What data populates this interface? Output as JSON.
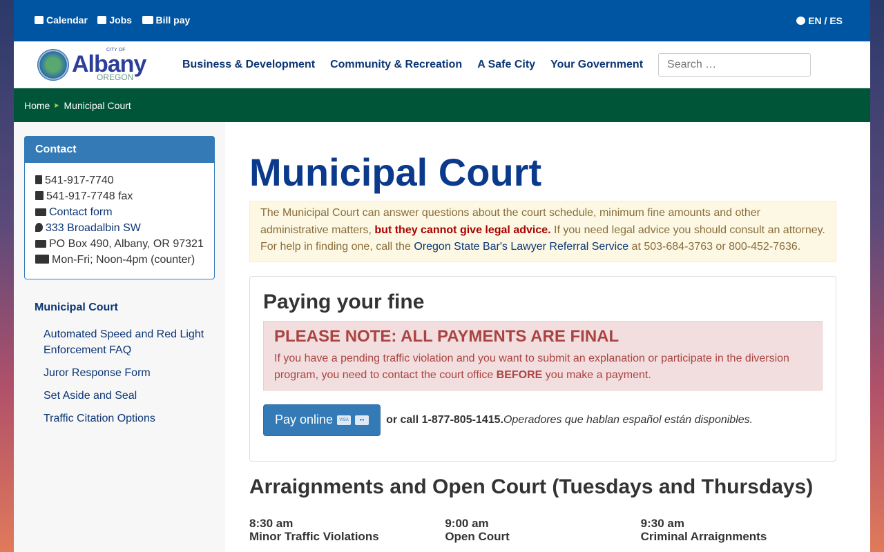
{
  "topbar": {
    "links": [
      {
        "label": "Calendar",
        "icon": "calendar-icon"
      },
      {
        "label": "Jobs",
        "icon": "briefcase-icon"
      },
      {
        "label": "Bill pay",
        "icon": "money-bill-icon"
      }
    ],
    "language": "EN / ES"
  },
  "logo": {
    "city_of": "CITY OF",
    "name": "Albany",
    "state": "OREGON"
  },
  "nav": [
    "Business & Development",
    "Community & Recreation",
    "A Safe City",
    "Your Government"
  ],
  "search": {
    "placeholder": "Search …"
  },
  "breadcrumb": [
    "Home",
    "Municipal Court"
  ],
  "contact": {
    "title": "Contact",
    "phone": "541-917-7740",
    "fax": "541-917-7748 fax",
    "form": "Contact form",
    "address": "333 Broadalbin SW",
    "po": "PO Box 490, Albany, OR 97321",
    "hours": "Mon-Fri; Noon-4pm (counter)"
  },
  "sidenav": {
    "title": "Municipal Court",
    "items": [
      "Automated Speed and Red Light Enforcement FAQ",
      "Juror Response Form",
      "Set Aside and Seal",
      "Traffic Citation Options"
    ]
  },
  "main": {
    "title": "Municipal Court",
    "notice": {
      "t1": "The Municipal Court can answer questions about the court schedule, minimum fine amounts and other administrative matters, ",
      "bold": "but they cannot give legal advice.",
      "t2": " If you need legal advice you should consult an attorney. For help in finding one, call the ",
      "link": "Oregon State Bar's Lawyer Referral Service",
      "t3": " at 503-684-3763 or 800-452-7636."
    },
    "paying": {
      "title": "Paying your fine",
      "alert_title": "PLEASE NOTE: ALL PAYMENTS ARE FINAL",
      "alert_t1": "If you have a pending traffic violation and you want to submit an explanation or participate in the diversion program, you need to contact the court office ",
      "alert_bold": "BEFORE",
      "alert_t2": " you make a payment.",
      "button": "Pay online",
      "visa": "VISA",
      "call": "or call 1-877-805-1415.",
      "spanish": " Operadores que hablan español están disponibles."
    },
    "arraign": {
      "title": "Arraignments and Open Court (Tuesdays and Thursdays)",
      "cols": [
        {
          "time": "8:30 am",
          "name": "Minor Traffic Violations"
        },
        {
          "time": "9:00 am",
          "name": "Open Court"
        },
        {
          "time": "9:30 am",
          "name": "Criminal Arraignments"
        }
      ]
    }
  }
}
